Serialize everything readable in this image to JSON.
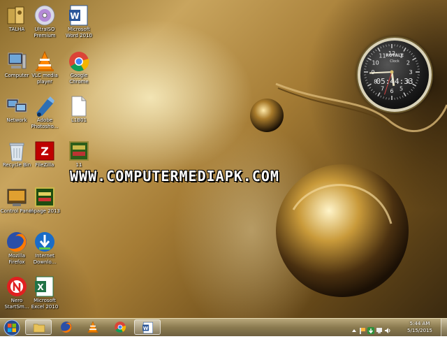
{
  "desktop_icons": [
    {
      "label": "TALHA",
      "icon": "user-folder-icon"
    },
    {
      "label": "UltraISO\nPremium",
      "icon": "ultraiso-disc-icon"
    },
    {
      "label": "Microsoft\nWord 2010",
      "icon": "word-icon"
    },
    {
      "label": "Computer",
      "icon": "computer-icon"
    },
    {
      "label": "VLC media\nplayer",
      "icon": "vlc-cone-icon"
    },
    {
      "label": "Google\nChrome",
      "icon": "chrome-icon"
    },
    {
      "label": "Network",
      "icon": "network-icon"
    },
    {
      "label": "Adobe\nPhotosho...",
      "icon": "photoshop-icon"
    },
    {
      "label": "L1B01",
      "icon": "blank-document-icon"
    },
    {
      "label": "Recycle Bin",
      "icon": "recycle-bin-icon"
    },
    {
      "label": "FileZilla",
      "icon": "filezilla-icon"
    },
    {
      "label": "11",
      "icon": "inpage-file-icon"
    },
    {
      "label": "Control Panel",
      "icon": "control-panel-icon"
    },
    {
      "label": "Inpage 2013",
      "icon": "inpage-icon"
    },
    {
      "label": "Mozilla\nFirefox",
      "icon": "firefox-icon"
    },
    {
      "label": "Internet\nDownlo...",
      "icon": "idm-icon"
    },
    {
      "label": "Nero\nStartSm...",
      "icon": "nero-icon"
    },
    {
      "label": "Microsoft\nExcel 2010",
      "icon": "excel-icon"
    }
  ],
  "watermark": "WWW.COMPUTERMEDIAPK.COM",
  "clock_gadget": {
    "brand": "ROYALE",
    "sub": "Clock",
    "digital_time": "05:44:33",
    "numerals": [
      "12",
      "1",
      "2",
      "3",
      "4",
      "5",
      "6",
      "7",
      "8",
      "9",
      "10",
      "11"
    ]
  },
  "taskbar": {
    "start": "windows-logo-icon",
    "pinned": [
      {
        "name": "explorer",
        "icon": "folder-icon",
        "active": true
      },
      {
        "name": "firefox",
        "icon": "firefox-icon",
        "active": false
      },
      {
        "name": "vlc",
        "icon": "vlc-cone-icon",
        "active": false
      },
      {
        "name": "chrome",
        "icon": "chrome-icon",
        "active": false
      },
      {
        "name": "word",
        "icon": "word-icon",
        "active": true
      }
    ],
    "tray": {
      "time": "5:44 AM",
      "date": "5/15/2015"
    }
  },
  "colors": {
    "taskbar": "#8a7a4f",
    "wallpaper_light": "#f5e8b9",
    "wallpaper_dark": "#3b2a10"
  }
}
